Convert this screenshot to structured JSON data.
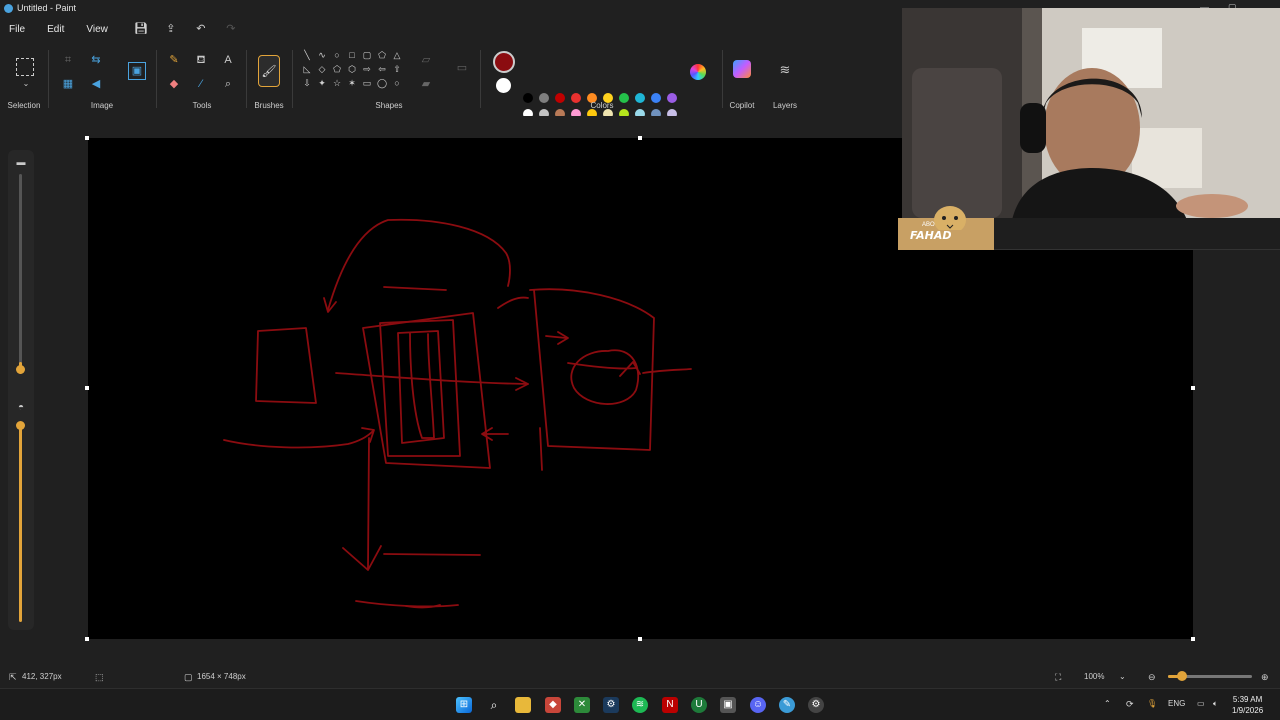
{
  "window": {
    "title": "Untitled - Paint"
  },
  "menu": {
    "file": "File",
    "edit": "Edit",
    "view": "View"
  },
  "ribbon": {
    "groups": {
      "selection": "Selection",
      "image": "Image",
      "tools": "Tools",
      "brushes": "Brushes",
      "shapes": "Shapes",
      "colors": "Colors",
      "copilot": "Copilot",
      "layers": "Layers"
    },
    "current_color": "#8b0c10",
    "secondary_color": "#ffffff",
    "palette_row1": [
      "#000000",
      "#7f7f7f",
      "#c00000",
      "#e8312f",
      "#ff8c21",
      "#ffd21e",
      "#24c04a",
      "#1fb6d6",
      "#3b82f6",
      "#9b5de5"
    ],
    "palette_row2": [
      "#ffffff",
      "#c3c3c3",
      "#b97a57",
      "#ff9bd4",
      "#ffc90e",
      "#efe4b0",
      "#b5e61d",
      "#99d9ea",
      "#7092be",
      "#c8bfe7"
    ]
  },
  "webcam_overlay": {
    "badge_text": "FAHAD",
    "badge_small": "ABO"
  },
  "status": {
    "cursor_position": "412, 327px",
    "canvas_size": "1654 × 748px",
    "zoom_level": "100%"
  },
  "taskbar": {
    "language": "ENG",
    "time": "5:39 AM",
    "date": "1/9/2026"
  }
}
